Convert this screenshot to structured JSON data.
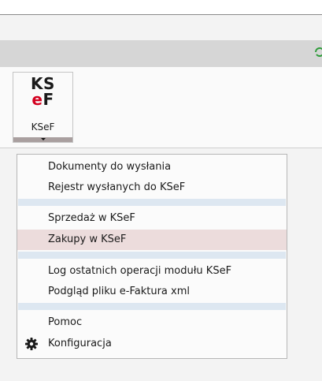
{
  "ribbon": {
    "kseF_button": {
      "logo_line1": "KS",
      "logo_line2_e": "e",
      "logo_line2_f": "F",
      "label": "KSeF"
    }
  },
  "icons": {
    "refresh": "refresh-icon",
    "gear": "gear-icon",
    "dropdown": "dropdown-arrow-icon"
  },
  "colors": {
    "accent_red": "#d3001f",
    "refresh_green": "#2e9c3a",
    "highlight": "#ecdcdc",
    "separator": "#dde7f1"
  },
  "menu": {
    "items": [
      {
        "label": "Dokumenty do wysłania"
      },
      {
        "label": "Rejestr wysłanych do KSeF"
      },
      {
        "label": "Sprzedaż w KSeF"
      },
      {
        "label": "Zakupy w KSeF"
      },
      {
        "label": "Log ostatnich operacji modułu KSeF"
      },
      {
        "label": "Podgląd pliku e-Faktura xml"
      },
      {
        "label": "Pomoc"
      },
      {
        "label": "Konfiguracja"
      }
    ]
  }
}
